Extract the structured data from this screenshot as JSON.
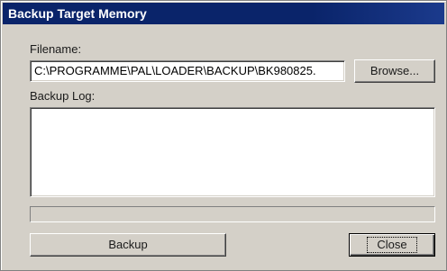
{
  "window": {
    "title": "Backup Target Memory"
  },
  "filename": {
    "label": "Filename:",
    "value": "C:\\PROGRAMME\\PAL\\LOADER\\BACKUP\\BK980825."
  },
  "browse_button": {
    "label": "Browse..."
  },
  "backup_log": {
    "label": "Backup Log:",
    "entries": []
  },
  "progress": {
    "value": 0
  },
  "buttons": {
    "backup_label": "Backup",
    "close_label": "Close"
  },
  "colors": {
    "titlebar": "#0a246a",
    "face": "#d4d0c8"
  }
}
